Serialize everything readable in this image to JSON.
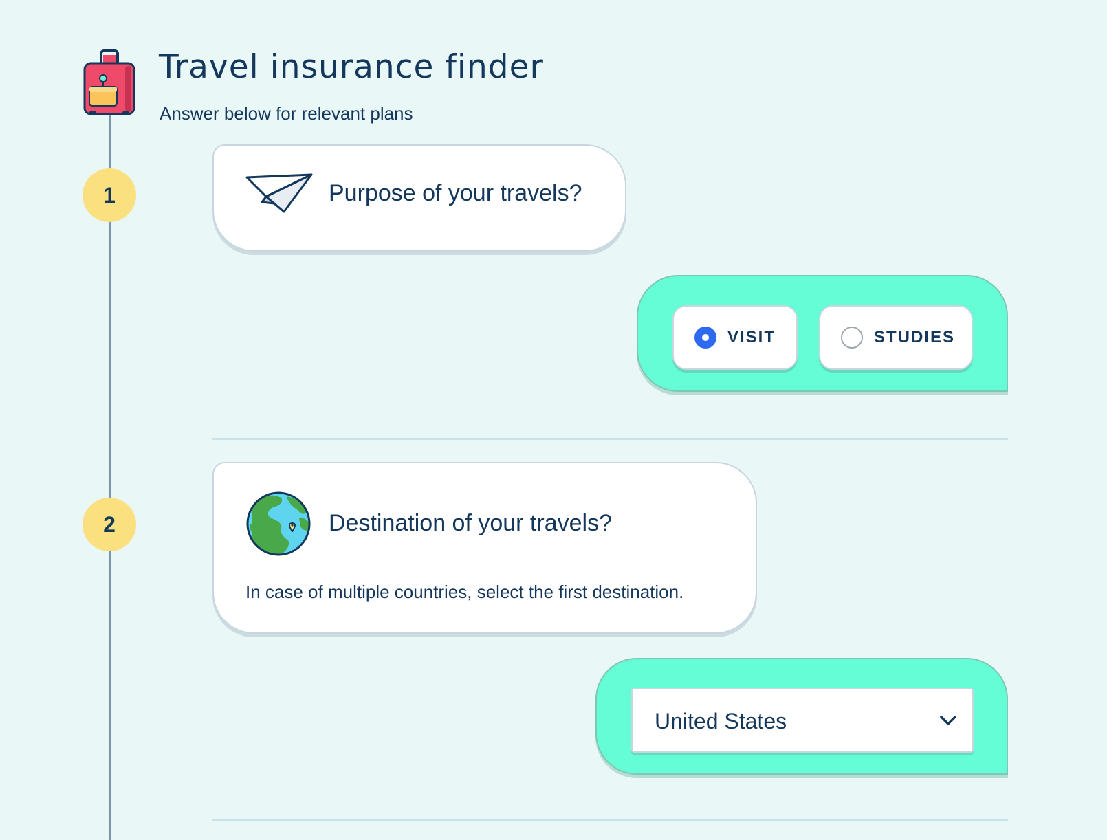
{
  "header": {
    "title": "Travel insurance finder",
    "subtitle": "Answer below for relevant plans",
    "icon": "luggage-icon"
  },
  "steps": [
    {
      "number": "1",
      "question": "Purpose of your travels?",
      "icon": "paper-plane-icon",
      "options": [
        {
          "label": "VISIT",
          "selected": true
        },
        {
          "label": "STUDIES",
          "selected": false
        }
      ]
    },
    {
      "number": "2",
      "question": "Destination of your travels?",
      "icon": "globe-icon",
      "hint": "In case of multiple countries, select the first destination.",
      "select": {
        "value": "United States",
        "icon": "chevron-down-icon"
      }
    }
  ],
  "colors": {
    "background": "#e9f7f7",
    "text": "#14375c",
    "badge": "#fbe07f",
    "answer_panel": "#64fdd6",
    "radio_selected": "#2e6af0",
    "timeline": "#7d95a8"
  }
}
